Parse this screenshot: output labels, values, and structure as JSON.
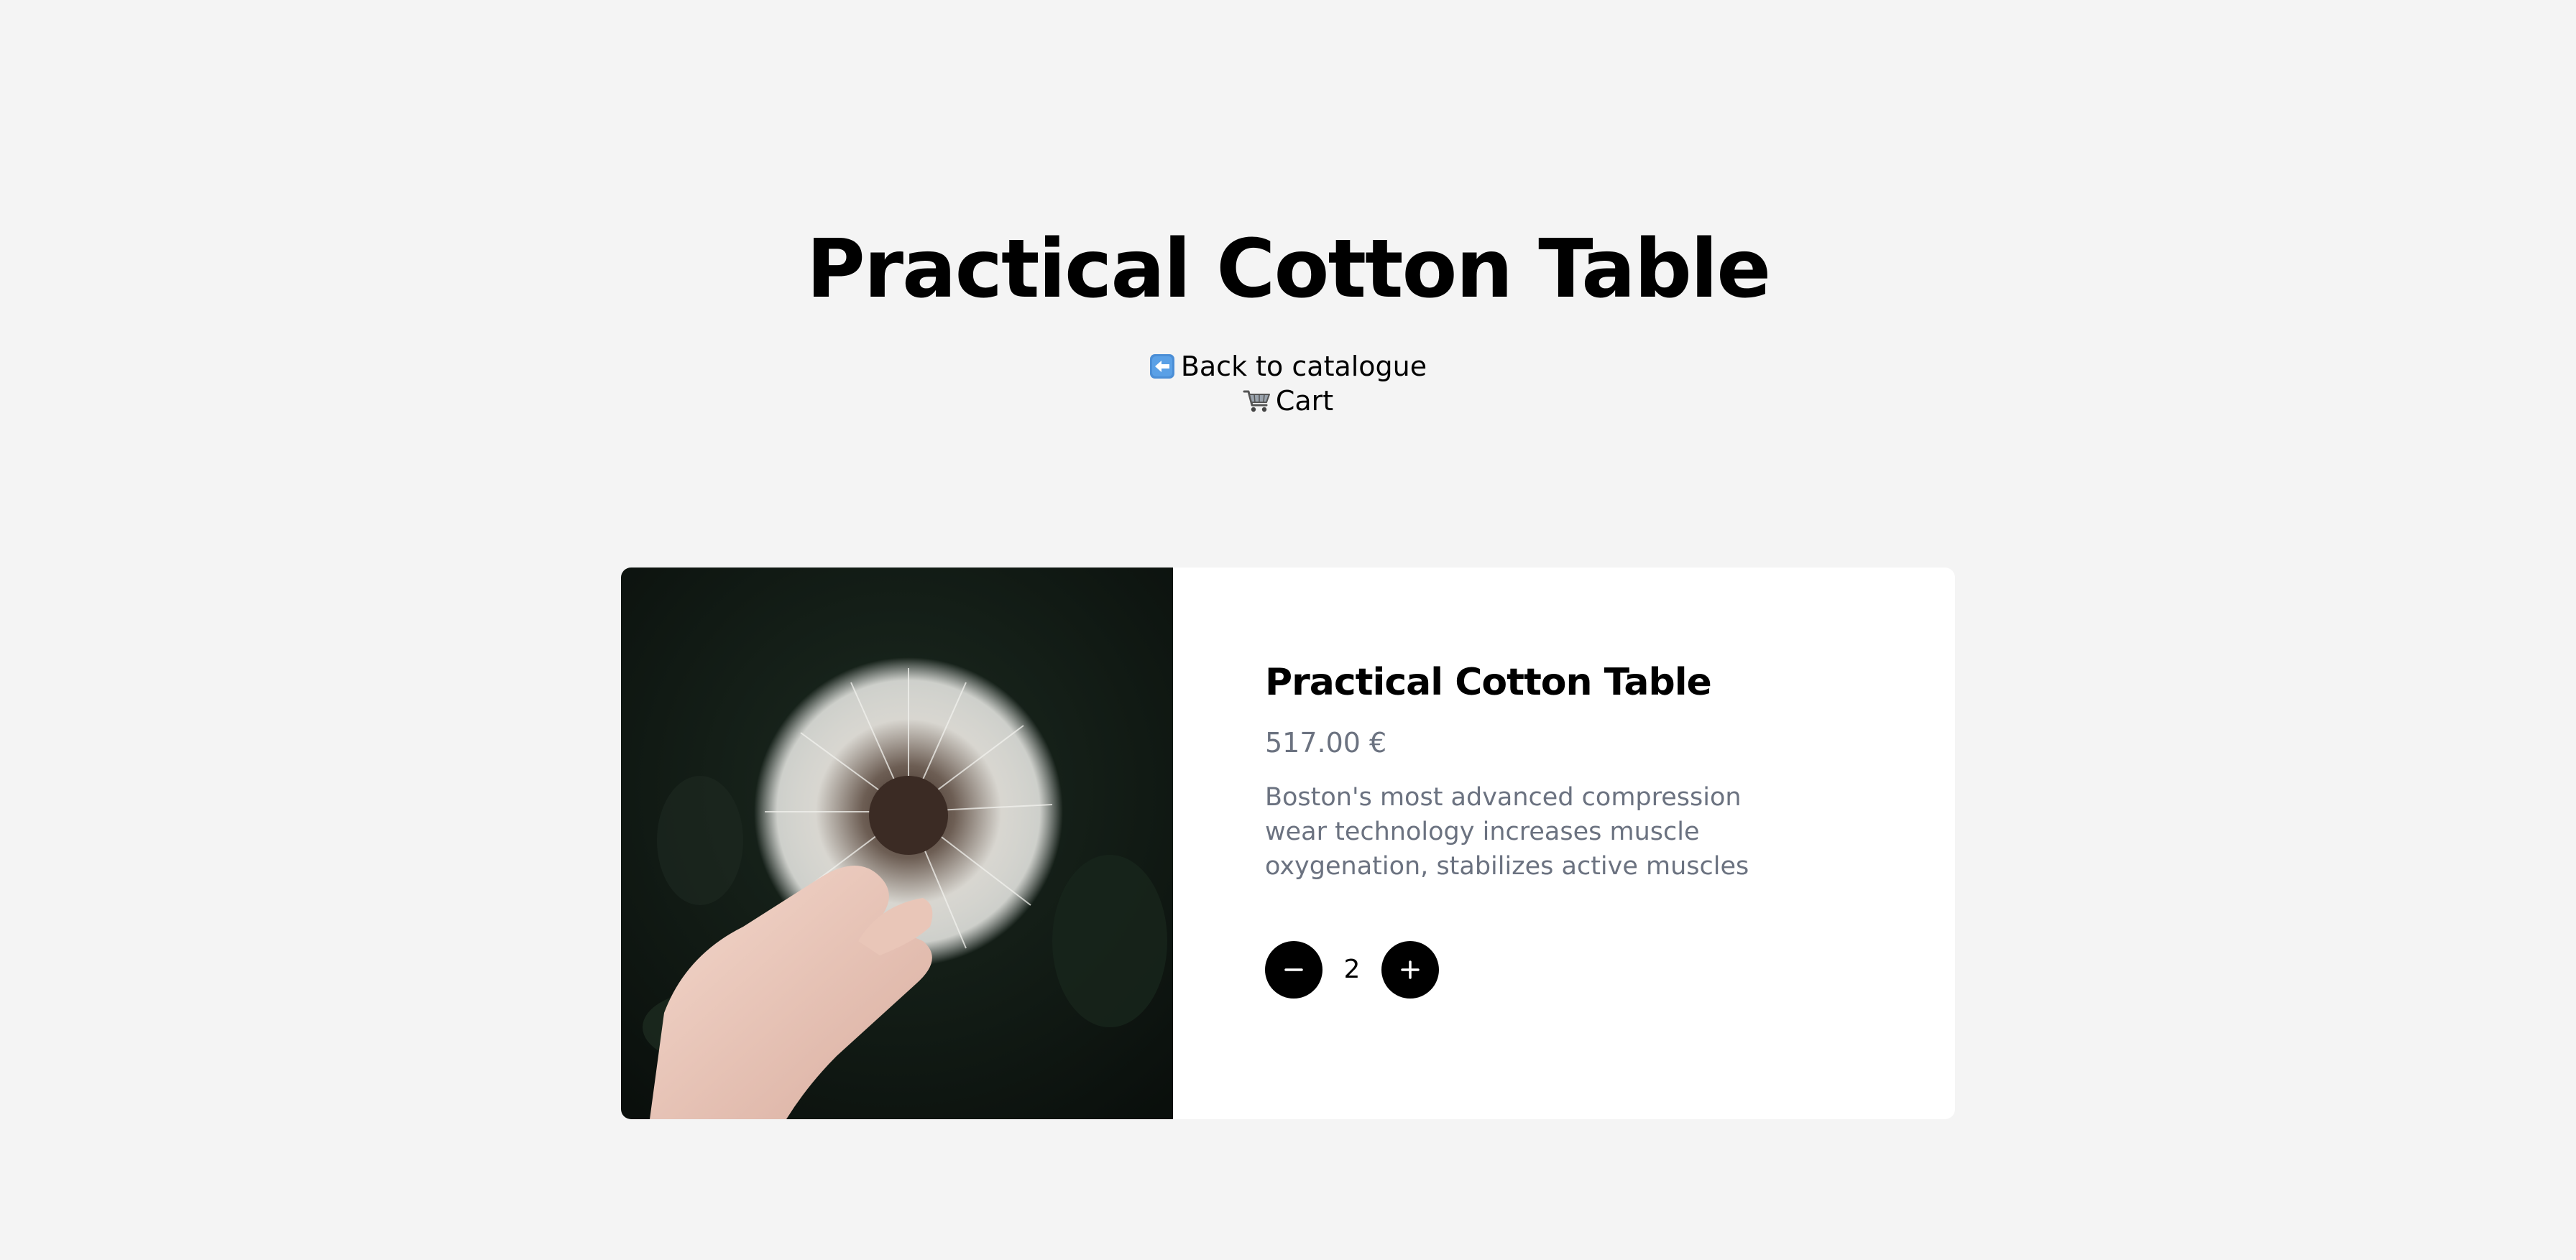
{
  "page": {
    "title": "Practical Cotton Table"
  },
  "nav": {
    "back_icon": "left-arrow-emoji-icon",
    "back_label": "Back to catalogue",
    "cart_icon": "shopping-cart-emoji-icon",
    "cart_label": "Cart"
  },
  "product": {
    "name": "Practical Cotton Table",
    "price": "517.00 €",
    "description": "Boston's most advanced compression wear technology increases muscle oxygenation, stabilizes active muscles",
    "image_icon": "dandelion-photo",
    "quantity": "2",
    "decrease_icon": "minus-icon",
    "increase_icon": "plus-icon"
  },
  "colors": {
    "background": "#f4f4f4",
    "card": "#ffffff",
    "text": "#000000",
    "muted_text": "#6b7280",
    "button": "#000000"
  }
}
